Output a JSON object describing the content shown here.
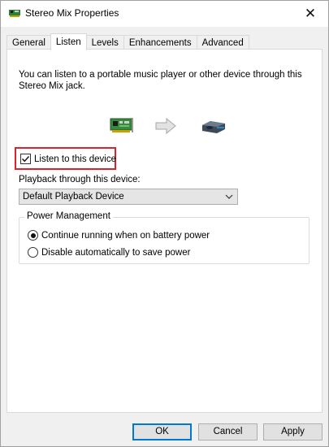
{
  "window": {
    "title": "Stereo Mix Properties",
    "close_glyph": "✕"
  },
  "tabs": [
    {
      "label": "General"
    },
    {
      "label": "Listen"
    },
    {
      "label": "Levels"
    },
    {
      "label": "Enhancements"
    },
    {
      "label": "Advanced"
    }
  ],
  "active_tab": "Listen",
  "listen": {
    "description": "You can listen to a portable music player or other device through this Stereo Mix jack.",
    "listen_checkbox_label": "Listen to this device",
    "listen_checked": true,
    "playback_label": "Playback through this device:",
    "playback_selected": "Default Playback Device",
    "power_group_label": "Power Management",
    "power_options": [
      {
        "label": "Continue running when on battery power",
        "selected": true
      },
      {
        "label": "Disable automatically to save power",
        "selected": false
      }
    ]
  },
  "buttons": {
    "ok": "OK",
    "cancel": "Cancel",
    "apply": "Apply"
  },
  "icons": {
    "title": "sound-card-icon",
    "source": "sound-card-icon",
    "arrow": "right-arrow-icon",
    "destination": "speaker-device-icon"
  },
  "colors": {
    "highlight": "#d9232d",
    "default_button_border": "#0078d7"
  }
}
